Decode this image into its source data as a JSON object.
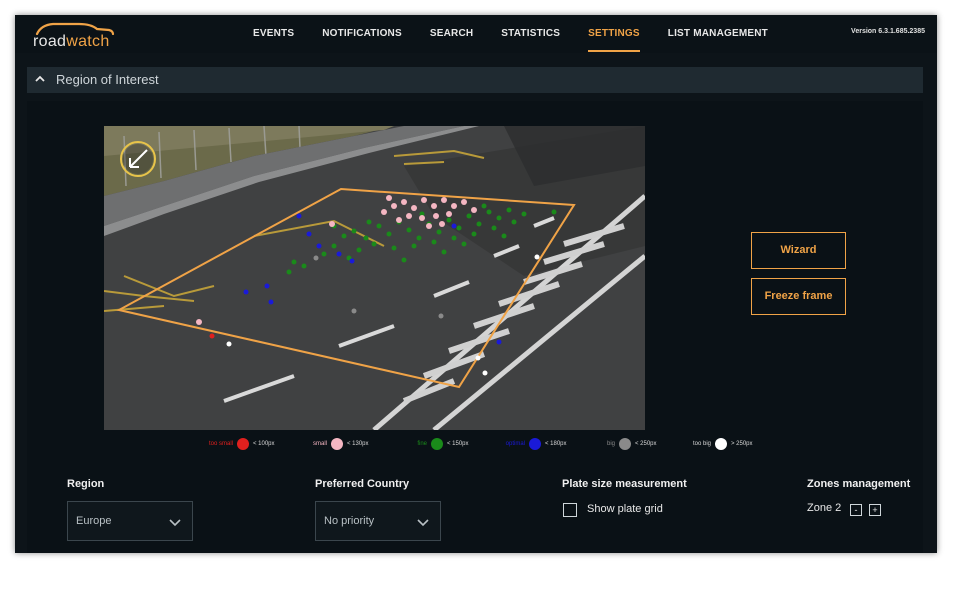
{
  "app": {
    "logo_text_prefix": "road",
    "logo_text_suffix": "watch",
    "version": "Version 6.3.1.685.2385",
    "accent_color": "#f0a347"
  },
  "nav": {
    "items": [
      {
        "label": "EVENTS",
        "active": false
      },
      {
        "label": "NOTIFICATIONS",
        "active": false
      },
      {
        "label": "SEARCH",
        "active": false
      },
      {
        "label": "STATISTICS",
        "active": false
      },
      {
        "label": "SETTINGS",
        "active": true
      },
      {
        "label": "LIST MANAGEMENT",
        "active": false
      }
    ]
  },
  "section": {
    "title": "Region of Interest",
    "expanded": true,
    "icon": "chevron-up-icon"
  },
  "camera": {
    "expand_icon": "collapse-arrow-icon",
    "roi_color": "#f0a347"
  },
  "buttons": {
    "wizard": "Wizard",
    "freeze_frame": "Freeze frame"
  },
  "legend": [
    {
      "label": "too small",
      "size": "< 100px",
      "color": "#e0201e"
    },
    {
      "label": "small",
      "size": "< 130px",
      "color": "#f4b6c2"
    },
    {
      "label": "fine",
      "size": "< 150px",
      "color": "#1a8a1a"
    },
    {
      "label": "optimal",
      "size": "< 180px",
      "color": "#1a1ad8"
    },
    {
      "label": "big",
      "size": "< 250px",
      "color": "#8a8a8a"
    },
    {
      "label": "too big",
      "size": "> 250px",
      "color": "#ffffff"
    }
  ],
  "region": {
    "label": "Region",
    "value": "Europe"
  },
  "preferred_country": {
    "label": "Preferred Country",
    "value": "No priority"
  },
  "plate_size": {
    "label": "Plate size measurement",
    "checkbox_label": "Show plate grid",
    "checked": false
  },
  "zones": {
    "label": "Zones management",
    "current": "Zone 2",
    "minus": "-",
    "plus": "+"
  }
}
